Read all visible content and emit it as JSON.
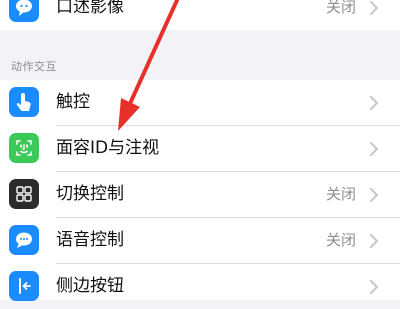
{
  "top_group": {
    "row_audio_description": {
      "label": "口述影像",
      "value": "关闭",
      "icon": "speech-bubble-icon",
      "icon_color": "#1a8cff"
    }
  },
  "section_interaction": {
    "header": "动作交互",
    "rows": [
      {
        "label": "触控",
        "value": "",
        "icon": "hand-pointer-icon",
        "icon_color": "#1a8cff"
      },
      {
        "label": "面容ID与注视",
        "value": "",
        "icon": "face-id-icon",
        "icon_color": "#3cc95a"
      },
      {
        "label": "切换控制",
        "value": "关闭",
        "icon": "grid-switch-icon",
        "icon_color": "#2b2b2b"
      },
      {
        "label": "语音控制",
        "value": "关闭",
        "icon": "voice-bubble-icon",
        "icon_color": "#1a8cff"
      },
      {
        "label": "侧边按钮",
        "value": "",
        "icon": "side-button-icon",
        "icon_color": "#1a8cff"
      }
    ]
  },
  "annotation": {
    "arrow_color": "#e8302a"
  }
}
